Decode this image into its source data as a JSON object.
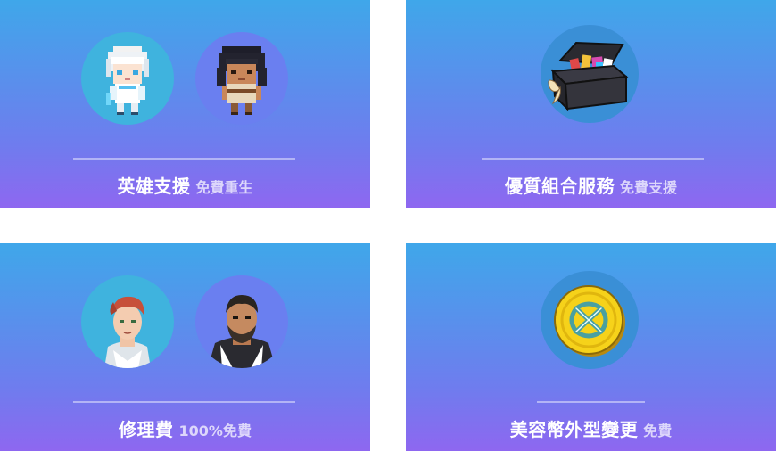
{
  "cards": [
    {
      "title": "英雄支援",
      "subtitle": "免費重生",
      "icons": [
        "white-haired-hero-portrait-icon",
        "dark-haired-hero-portrait-icon"
      ]
    },
    {
      "title": "優質組合服務",
      "subtitle": "免費支援",
      "icons": [
        "item-chest-icon"
      ]
    },
    {
      "title": "修理費",
      "subtitle": "100%免費",
      "icons": [
        "red-haired-npc-portrait-icon",
        "bearded-npc-portrait-icon"
      ]
    },
    {
      "title": "美容幣外型變更",
      "subtitle": "免費",
      "icons": [
        "gold-coin-icon"
      ]
    }
  ],
  "colors": {
    "card_gradient_top": "#3fa7ea",
    "card_gradient_bottom": "#8e67f0",
    "avatar_bg_blue": "#3fb3de",
    "avatar_bg_purple": "#6a7ff0",
    "text": "#ffffff"
  }
}
